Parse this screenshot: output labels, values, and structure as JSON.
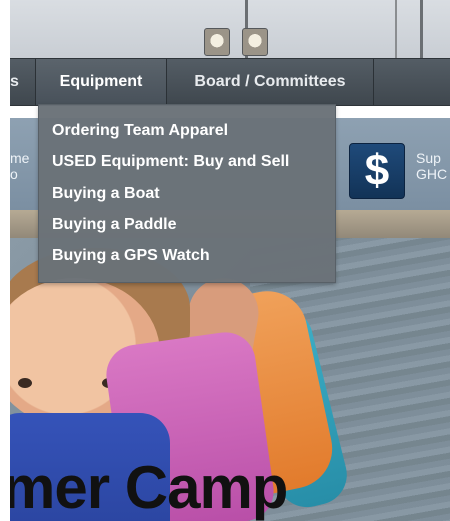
{
  "nav": {
    "partial_left": "s",
    "items": [
      {
        "label": "Equipment"
      },
      {
        "label": "Board / Committees"
      }
    ]
  },
  "dropdown": {
    "items": [
      {
        "label": "Ordering Team Apparel"
      },
      {
        "label": "USED Equipment: Buy and Sell"
      },
      {
        "label": "Buying a Boat"
      },
      {
        "label": "Buying a Paddle"
      },
      {
        "label": "Buying a GPS Watch"
      }
    ]
  },
  "band": {
    "left_line1": "me",
    "left_line2": "o",
    "dollar_symbol": "$",
    "right_line1": "Sup",
    "right_line2": "GHC"
  },
  "hero": {
    "title_partial": "mer Camp"
  },
  "colors": {
    "nav_bg": "#454d55",
    "dropdown_bg": "#6a7278",
    "dollar_box": "#1a3f6b"
  }
}
